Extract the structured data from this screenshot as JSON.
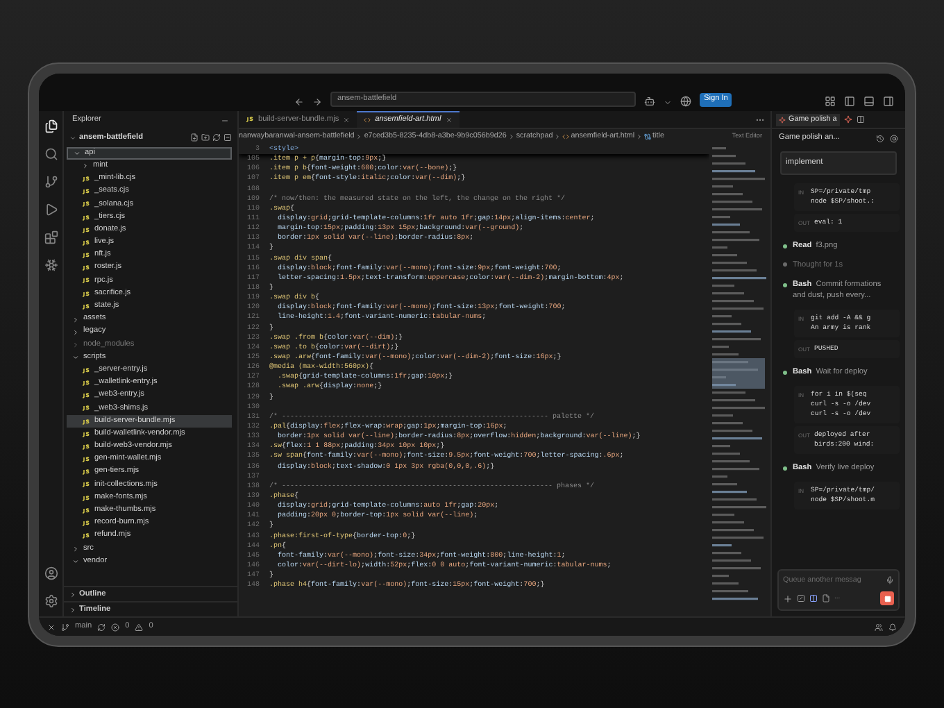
{
  "titlebar": {
    "search": "ansem-battlefield",
    "sign_in": "Sign In"
  },
  "activity_bar": [
    {
      "selected": true
    },
    {
      "selected": false
    },
    {
      "selected": false
    },
    {
      "selected": false
    },
    {
      "selected": false
    },
    {
      "selected": false
    }
  ],
  "explorer": {
    "title": "Explorer",
    "root": "ansem-battlefield",
    "tree": [
      {
        "name": "api",
        "kind": "folder",
        "expanded": true,
        "selected": true,
        "dimmed": false,
        "children": [
          {
            "name": "mint",
            "kind": "folder",
            "expanded": false,
            "selected": false,
            "dimmed": false
          },
          {
            "name": "_mint-lib.cjs",
            "kind": "file",
            "selected": false,
            "dimmed": false
          },
          {
            "name": "_seats.cjs",
            "kind": "file",
            "selected": false,
            "dimmed": false
          },
          {
            "name": "_solana.cjs",
            "kind": "file",
            "selected": false,
            "dimmed": false
          },
          {
            "name": "_tiers.cjs",
            "kind": "file",
            "selected": false,
            "dimmed": false
          },
          {
            "name": "donate.js",
            "kind": "file",
            "selected": false,
            "dimmed": false
          },
          {
            "name": "live.js",
            "kind": "file",
            "selected": false,
            "dimmed": false
          },
          {
            "name": "nft.js",
            "kind": "file",
            "selected": false,
            "dimmed": false
          },
          {
            "name": "roster.js",
            "kind": "file",
            "selected": false,
            "dimmed": false
          },
          {
            "name": "rpc.js",
            "kind": "file",
            "selected": false,
            "dimmed": false
          },
          {
            "name": "sacrifice.js",
            "kind": "file",
            "selected": false,
            "dimmed": false
          },
          {
            "name": "state.js",
            "kind": "file",
            "selected": false,
            "dimmed": false
          }
        ]
      },
      {
        "name": "assets",
        "kind": "folder",
        "expanded": false,
        "selected": false,
        "dimmed": false
      },
      {
        "name": "legacy",
        "kind": "folder",
        "expanded": false,
        "selected": false,
        "dimmed": false
      },
      {
        "name": "node_modules",
        "kind": "folder",
        "expanded": false,
        "selected": false,
        "dimmed": true
      },
      {
        "name": "scripts",
        "kind": "folder",
        "expanded": true,
        "selected": false,
        "dimmed": false,
        "children": [
          {
            "name": "_server-entry.js",
            "kind": "file",
            "selected": false,
            "dimmed": false
          },
          {
            "name": "_walletlink-entry.js",
            "kind": "file",
            "selected": false,
            "dimmed": false
          },
          {
            "name": "_web3-entry.js",
            "kind": "file",
            "selected": false,
            "dimmed": false
          },
          {
            "name": "_web3-shims.js",
            "kind": "file",
            "selected": false,
            "dimmed": false
          },
          {
            "name": "build-server-bundle.mjs",
            "kind": "file",
            "selected": true,
            "dimmed": false
          },
          {
            "name": "build-walletlink-vendor.mjs",
            "kind": "file",
            "selected": false,
            "dimmed": false
          },
          {
            "name": "build-web3-vendor.mjs",
            "kind": "file",
            "selected": false,
            "dimmed": false
          },
          {
            "name": "gen-mint-wallet.mjs",
            "kind": "file",
            "selected": false,
            "dimmed": false
          },
          {
            "name": "gen-tiers.mjs",
            "kind": "file",
            "selected": false,
            "dimmed": false
          },
          {
            "name": "init-collections.mjs",
            "kind": "file",
            "selected": false,
            "dimmed": false
          },
          {
            "name": "make-fonts.mjs",
            "kind": "file",
            "selected": false,
            "dimmed": false
          },
          {
            "name": "make-thumbs.mjs",
            "kind": "file",
            "selected": false,
            "dimmed": false
          },
          {
            "name": "record-burn.mjs",
            "kind": "file",
            "selected": false,
            "dimmed": false
          },
          {
            "name": "refund.mjs",
            "kind": "file",
            "selected": false,
            "dimmed": false
          }
        ]
      },
      {
        "name": "src",
        "kind": "folder",
        "expanded": false,
        "selected": false,
        "dimmed": false
      },
      {
        "name": "vendor",
        "kind": "folder",
        "expanded": true,
        "selected": false,
        "dimmed": false
      }
    ],
    "sections": [
      {
        "title": "Outline",
        "expanded": false
      },
      {
        "title": "Timeline",
        "expanded": false
      }
    ]
  },
  "editor": {
    "tabs": [
      {
        "label": "build-server-bundle.mjs",
        "kind": "js",
        "selected": false
      },
      {
        "label": "ansemfield-art.html",
        "kind": "html",
        "selected": true
      }
    ],
    "breadcrumbs": [
      "nanwaybaranwal-ansem-battlefield",
      "e7ced3b5-8235-4db8-a3be-9b9c056b9d26",
      "scratchpad",
      "ansemfield-art.html",
      "title"
    ],
    "mode": "Text Editor",
    "sticky": {
      "n": "3",
      "text": "<style>"
    },
    "lines": [
      {
        "n": "105",
        "text": ".item p + p{margin-top:9px;}"
      },
      {
        "n": "106",
        "text": ".item p b{font-weight:600;color:var(--bone);}"
      },
      {
        "n": "107",
        "text": ".item p em{font-style:italic;color:var(--dim);}"
      },
      {
        "n": "108"
      },
      {
        "n": "109",
        "text": "/* now/then: the measured state on the left, the change on the right */"
      },
      {
        "n": "110",
        "text": ".swap{"
      },
      {
        "n": "111",
        "text": "  display:grid;grid-template-columns:1fr auto 1fr;gap:14px;align-items:center;"
      },
      {
        "n": "112",
        "text": "  margin-top:15px;padding:13px 15px;background:var(--ground);"
      },
      {
        "n": "113",
        "text": "  border:1px solid var(--line);border-radius:8px;"
      },
      {
        "n": "114",
        "text": "}"
      },
      {
        "n": "115",
        "text": ".swap div span{"
      },
      {
        "n": "116",
        "text": "  display:block;font-family:var(--mono);font-size:9px;font-weight:700;"
      },
      {
        "n": "117",
        "text": "  letter-spacing:1.5px;text-transform:uppercase;color:var(--dim-2);margin-bottom:4px;"
      },
      {
        "n": "118",
        "text": "}"
      },
      {
        "n": "119",
        "text": ".swap div b{"
      },
      {
        "n": "120",
        "text": "  display:block;font-family:var(--mono);font-size:13px;font-weight:700;"
      },
      {
        "n": "121",
        "text": "  line-height:1.4;font-variant-numeric:tabular-nums;"
      },
      {
        "n": "122",
        "text": "}"
      },
      {
        "n": "123",
        "text": ".swap .from b{color:var(--dim);}"
      },
      {
        "n": "124",
        "text": ".swap .to b{color:var(--dirt);}"
      },
      {
        "n": "125",
        "text": ".swap .arw{font-family:var(--mono);color:var(--dim-2);font-size:16px;}"
      },
      {
        "n": "126",
        "text": "@media (max-width:560px){"
      },
      {
        "n": "127",
        "text": "  .swap{grid-template-columns:1fr;gap:10px;}"
      },
      {
        "n": "128",
        "text": "  .swap .arw{display:none;}"
      },
      {
        "n": "129",
        "text": "}"
      },
      {
        "n": "130"
      },
      {
        "n": "131",
        "text": "/* ---------------------------------------------------------------- palette */"
      },
      {
        "n": "132",
        "text": ".pal{display:flex;flex-wrap:wrap;gap:1px;margin-top:16px;"
      },
      {
        "n": "133",
        "text": "  border:1px solid var(--line);border-radius:8px;overflow:hidden;background:var(--line);}"
      },
      {
        "n": "134",
        "text": ".sw{flex:1 1 88px;padding:34px 10px 10px;}"
      },
      {
        "n": "135",
        "text": ".sw span{font-family:var(--mono);font-size:9.5px;font-weight:700;letter-spacing:.6px;"
      },
      {
        "n": "136",
        "text": "  display:block;text-shadow:0 1px 3px rgba(0,0,0,.6);}"
      },
      {
        "n": "137"
      },
      {
        "n": "138",
        "text": "/* ----------------------------------------------------------------- phases */"
      },
      {
        "n": "139",
        "text": ".phase{"
      },
      {
        "n": "140",
        "text": "  display:grid;grid-template-columns:auto 1fr;gap:20px;"
      },
      {
        "n": "141",
        "text": "  padding:20px 0;border-top:1px solid var(--line);"
      },
      {
        "n": "142",
        "text": "}"
      },
      {
        "n": "143",
        "text": ".phase:first-of-type{border-top:0;}"
      },
      {
        "n": "144",
        "text": ".pn{"
      },
      {
        "n": "145",
        "text": "  font-family:var(--mono);font-size:34px;font-weight:800;line-height:1;"
      },
      {
        "n": "146",
        "text": "  color:var(--dirt-lo);width:52px;flex:0 0 auto;font-variant-numeric:tabular-nums;"
      },
      {
        "n": "147",
        "text": "}"
      },
      {
        "n": "148",
        "text": ".phase h4{font-family:var(--mono);font-size:15px;font-weight:700;}"
      }
    ]
  },
  "chat": {
    "tab": "Game polish a",
    "title": "Game polish an...",
    "steps": [
      {
        "kind": "heading",
        "text": "implement"
      },
      {
        "kind": "io",
        "in_label": "IN",
        "in": [
          "SP=/private/tmp",
          "node $SP/shoot.:"
        ],
        "out_label": "OUT",
        "out": [
          "eval: 1"
        ]
      },
      {
        "kind": "step",
        "tool": "Read",
        "text": "f3.png"
      },
      {
        "kind": "thought",
        "text": "Thought for 1s"
      },
      {
        "kind": "step",
        "tool": "Bash",
        "text": "Commit formations and dust, push every..."
      },
      {
        "kind": "io",
        "in_label": "IN",
        "in": [
          "git add -A && g",
          "An army is rank"
        ],
        "out_label": "OUT",
        "out": [
          "PUSHED"
        ]
      },
      {
        "kind": "step",
        "tool": "Bash",
        "text": "Wait for deploy"
      },
      {
        "kind": "io",
        "in_label": "IN",
        "in": [
          "for i in $(seq",
          "curl -s -o /dev",
          "curl -s -o /dev"
        ],
        "out_label": "OUT",
        "out": [
          "deployed after",
          "birds:200 wind:"
        ]
      },
      {
        "kind": "step",
        "tool": "Bash",
        "text": "Verify live deploy"
      },
      {
        "kind": "io",
        "in_label": "IN",
        "in": [
          "SP=/private/tmp/",
          "node $SP/shoot.m"
        ]
      }
    ],
    "input": {
      "placeholder": "Queue another messag"
    },
    "context": "..."
  },
  "status_bar": {
    "branch": "main",
    "errors": "0",
    "warnings": "0"
  }
}
